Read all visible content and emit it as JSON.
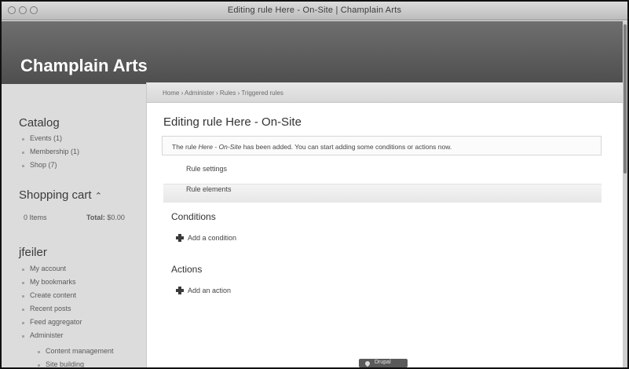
{
  "window": {
    "title": "Editing rule Here - On-Site | Champlain Arts"
  },
  "site": {
    "name": "Champlain Arts"
  },
  "breadcrumb": "Home › Administer › Rules › Triggered rules",
  "sidebar": {
    "catalog": {
      "title": "Catalog",
      "items": [
        {
          "label": "Events (1)"
        },
        {
          "label": "Membership (1)"
        },
        {
          "label": "Shop (7)"
        }
      ]
    },
    "cart": {
      "title": "Shopping cart",
      "toggle_symbol": "⌃",
      "items": "0 Items",
      "total_label": "Total:",
      "total_value": "$0.00"
    },
    "user": {
      "title": "jfeiler",
      "items": [
        {
          "label": "My account"
        },
        {
          "label": "My bookmarks"
        },
        {
          "label": "Create content"
        },
        {
          "label": "Recent posts"
        },
        {
          "label": "Feed aggregator"
        },
        {
          "label": "Administer"
        },
        {
          "label": "Content management"
        },
        {
          "label": "Site building"
        }
      ]
    }
  },
  "main": {
    "title": "Editing rule Here - On-Site",
    "message_prefix": "The rule ",
    "message_rule": "Here - On-Site",
    "message_suffix": " has been added. You can start adding some conditions or actions now.",
    "fieldsets": {
      "settings": "Rule settings",
      "elements": "Rule elements"
    },
    "conditions": {
      "title": "Conditions",
      "add_label": "Add a condition"
    },
    "actions": {
      "title": "Actions",
      "add_label": "Add an action"
    }
  },
  "footer": {
    "powered_by": "Drupal"
  },
  "colors": {
    "header_bg": "#5e5e5e",
    "sidebar_bg": "#dcdcdc",
    "content_bg": "#ffffff"
  }
}
